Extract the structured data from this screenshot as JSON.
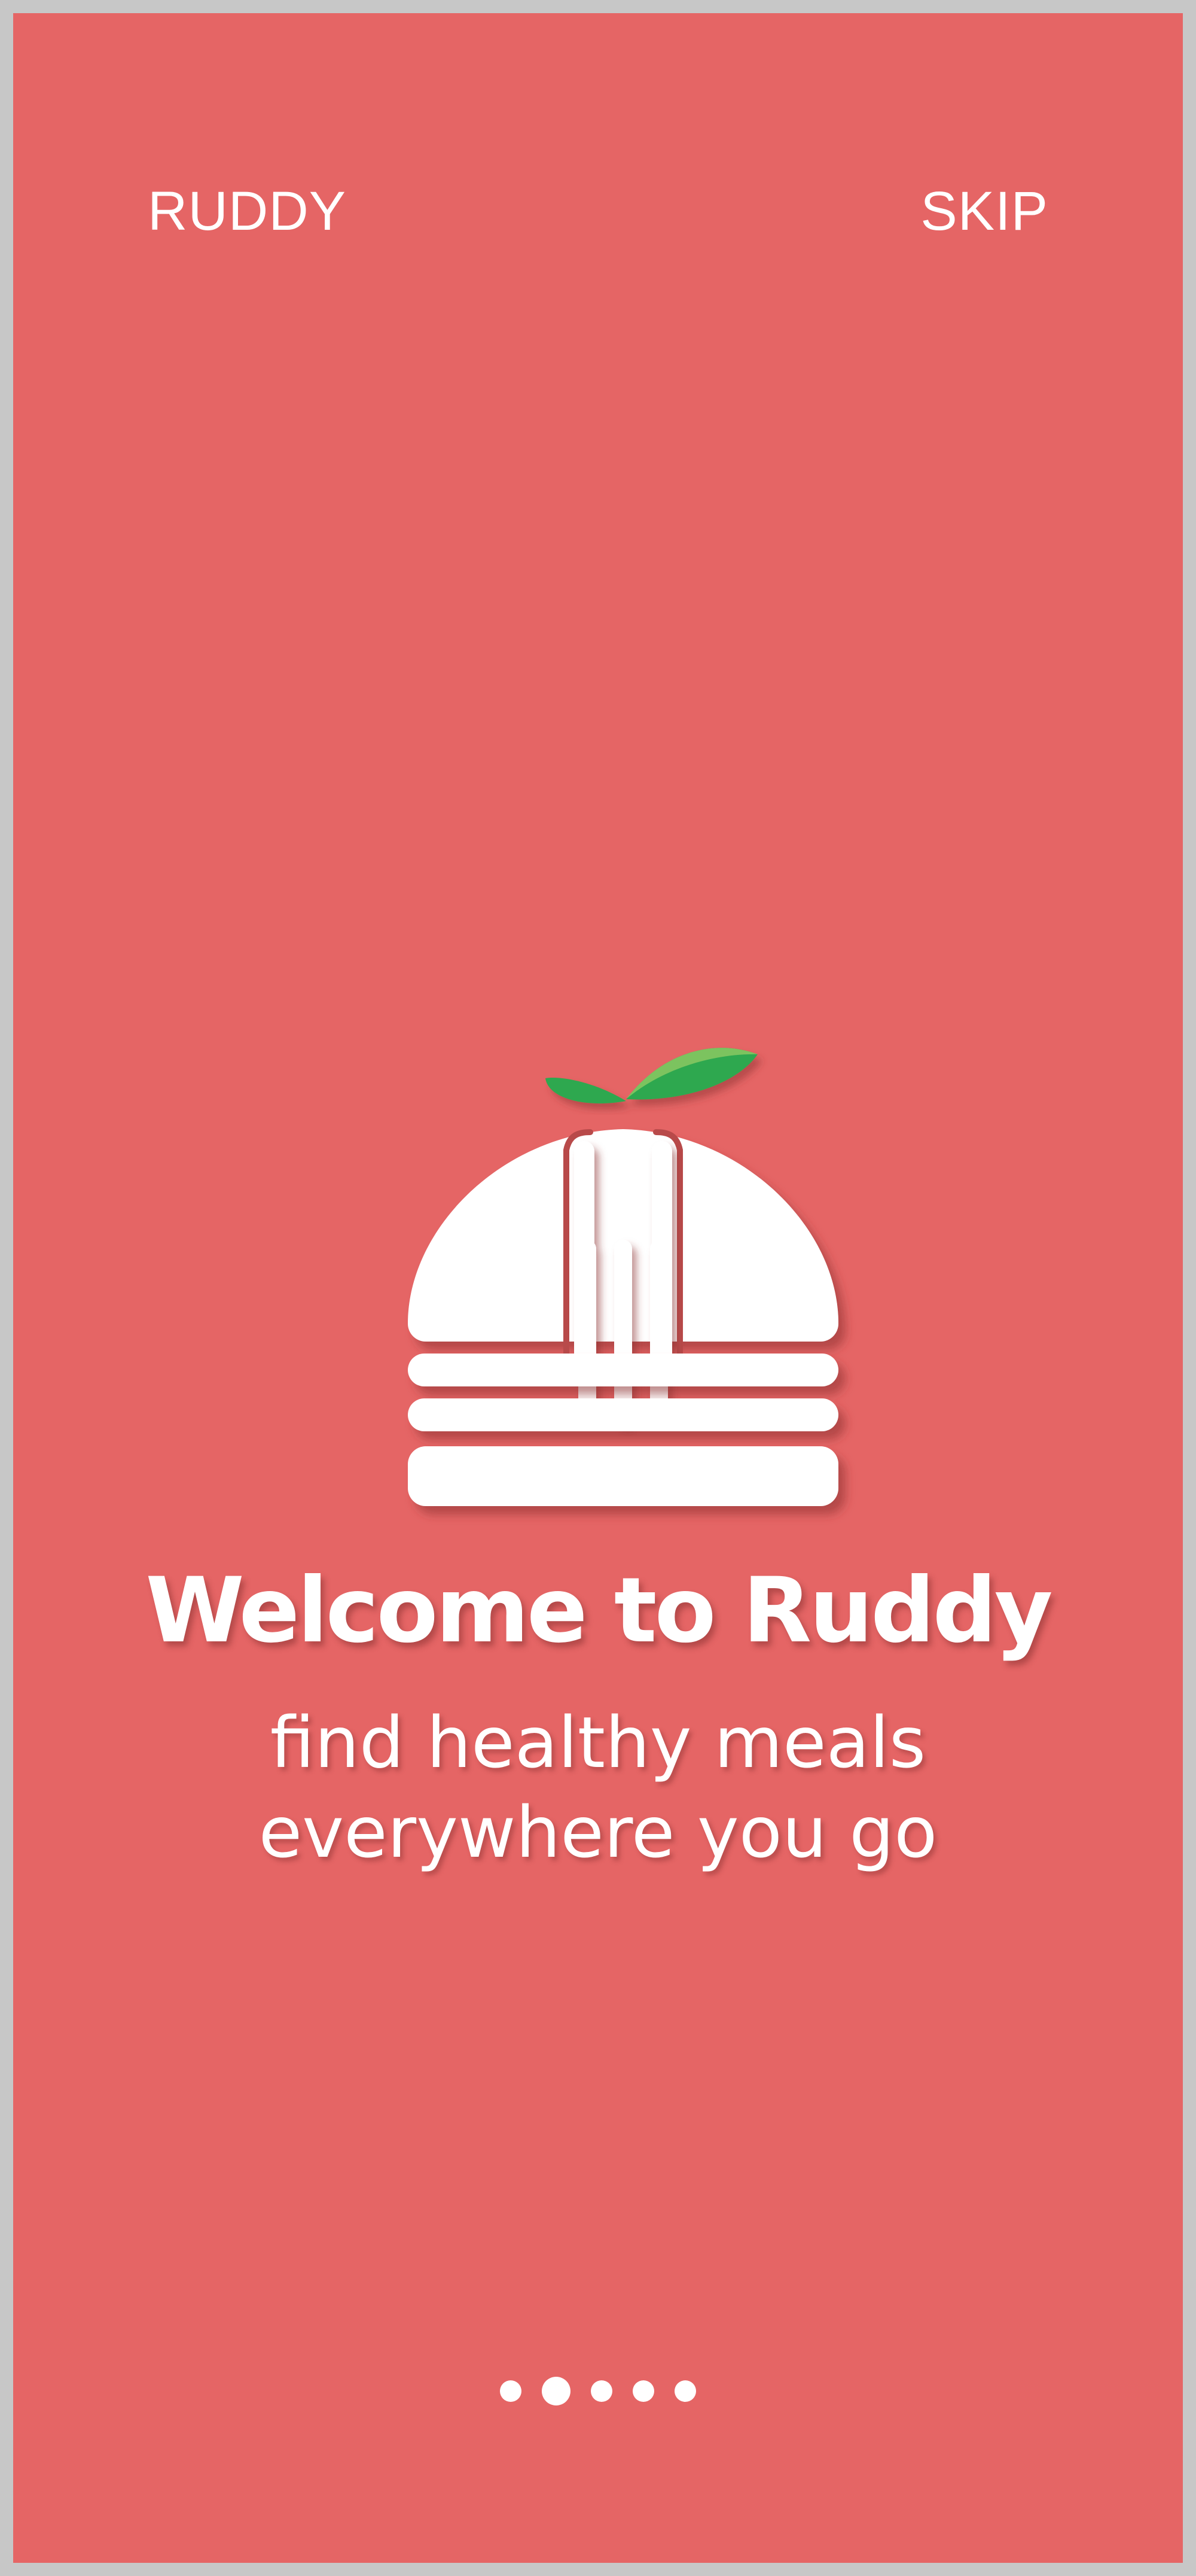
{
  "topbar": {
    "brand": "RUDDY",
    "skip_label": "SKIP"
  },
  "logo": {
    "icon": "burger-with-fork-and-leaf-icon",
    "colors": {
      "bun": "#ffffff",
      "leaf_dark": "#2fa84f",
      "leaf_light": "#7cc35f"
    }
  },
  "onboarding": {
    "title": "Welcome to Ruddy",
    "subtitle_line1": "find healthy meals",
    "subtitle_line2": "everywhere you go"
  },
  "pagination": {
    "total": 5,
    "current": 2
  },
  "colors": {
    "background": "#e56565",
    "frame": "#c7c7c7",
    "text": "#ffffff"
  }
}
